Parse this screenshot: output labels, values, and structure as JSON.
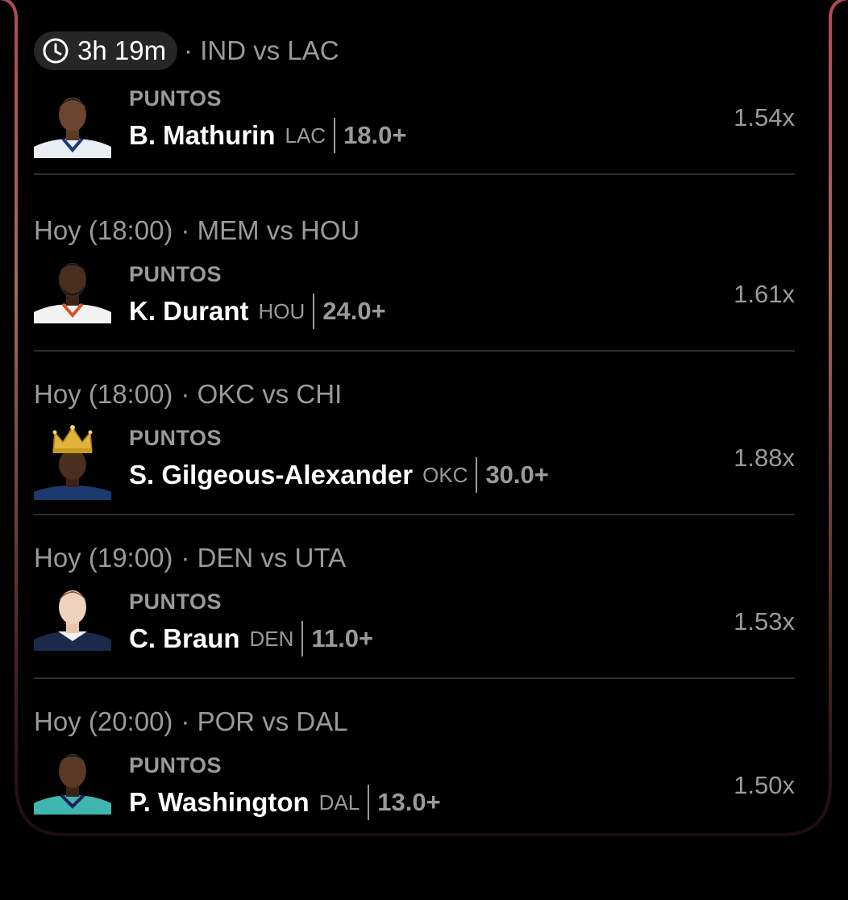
{
  "picks": [
    {
      "timer": "3h 19m",
      "match": "· IND vs LAC",
      "stat": "PUNTOS",
      "player": "B. Mathurin",
      "team": "LAC",
      "line": "18.0+",
      "multiplier": "1.54x",
      "jersey_color": "#e8eef4"
    },
    {
      "time": "Hoy (18:00)",
      "match": "· MEM vs HOU",
      "stat": "PUNTOS",
      "player": "K. Durant",
      "team": "HOU",
      "line": "24.0+",
      "multiplier": "1.61x",
      "jersey_color": "#f2f2f2"
    },
    {
      "time": "Hoy (18:00)",
      "match": "· OKC vs CHI",
      "stat": "PUNTOS",
      "player": "S. Gilgeous-Alexander",
      "team": "OKC",
      "line": "30.0+",
      "multiplier": "1.88x",
      "jersey_color": "#1d3a6e"
    },
    {
      "time": "Hoy (19:00)",
      "match": "· DEN vs UTA",
      "stat": "PUNTOS",
      "player": "C. Braun",
      "team": "DEN",
      "line": "11.0+",
      "multiplier": "1.53x",
      "jersey_color": "#1b2a4a"
    },
    {
      "time": "Hoy (20:00)",
      "match": "· POR vs DAL",
      "stat": "PUNTOS",
      "player": "P. Washington",
      "team": "DAL",
      "line": "13.0+",
      "multiplier": "1.50x",
      "jersey_color": "#3fb7b0"
    }
  ],
  "colors": {
    "frame_top": "#b0485e",
    "frame_mid": "#a26a5a",
    "frame_bottom": "#3a1a22",
    "muted_text": "#9a9a9a",
    "pill_bg": "#262626",
    "divider": "#2e2e2e"
  },
  "icons": {
    "timer": "clock-icon",
    "crown": "crown-icon"
  }
}
